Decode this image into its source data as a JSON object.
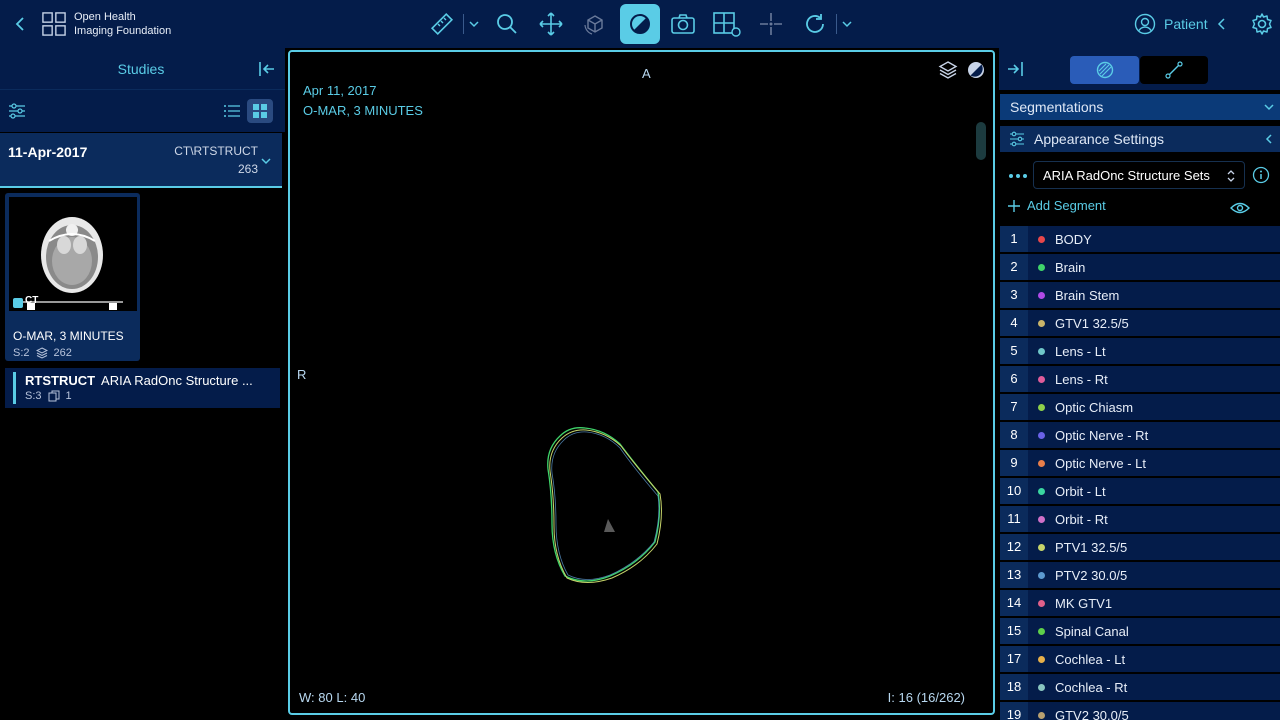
{
  "header": {
    "org_line1": "Open Health",
    "org_line2": "Imaging Foundation",
    "patient_label": "Patient"
  },
  "left_panel": {
    "title": "Studies",
    "study": {
      "date": "11-Apr-2017",
      "modalities": "CT\\RTSTRUCT",
      "instance_count": "263"
    },
    "series": {
      "thumb_label": "CT",
      "description": "O-MAR, 3 MINUTES",
      "series_num": "S:2",
      "instances": "262"
    },
    "rtstruct": {
      "modality": "RTSTRUCT",
      "description": "ARIA RadOnc Structure ...",
      "series_num": "S:3",
      "instances": "1"
    }
  },
  "viewport": {
    "date": "Apr 11, 2017",
    "description": "O-MAR, 3 MINUTES",
    "orientation_top": "A",
    "orientation_left": "R",
    "window_label": "W:",
    "window_value": "80",
    "level_label": "L:",
    "level_value": "40",
    "image_index": "I: 16 (16/262)"
  },
  "right_panel": {
    "segmentations_title": "Segmentations",
    "appearance_title": "Appearance Settings",
    "structure_set": "ARIA RadOnc Structure Sets",
    "add_segment_label": "Add Segment",
    "segments": [
      {
        "num": "1",
        "label": "BODY",
        "color": "#e8474b"
      },
      {
        "num": "2",
        "label": "Brain",
        "color": "#3fd46a"
      },
      {
        "num": "3",
        "label": "Brain Stem",
        "color": "#b04ae8"
      },
      {
        "num": "4",
        "label": "GTV1 32.5/5",
        "color": "#c9b46a"
      },
      {
        "num": "5",
        "label": "Lens - Lt",
        "color": "#6fc7c9"
      },
      {
        "num": "6",
        "label": "Lens - Rt",
        "color": "#e05c9a"
      },
      {
        "num": "7",
        "label": "Optic Chiasm",
        "color": "#8ed04a"
      },
      {
        "num": "8",
        "label": "Optic Nerve - Rt",
        "color": "#6a62e8"
      },
      {
        "num": "9",
        "label": "Optic Nerve - Lt",
        "color": "#e87e4a"
      },
      {
        "num": "10",
        "label": "Orbit - Lt",
        "color": "#3ad6a0"
      },
      {
        "num": "11",
        "label": "Orbit - Rt",
        "color": "#d070c8"
      },
      {
        "num": "12",
        "label": "PTV1 32.5/5",
        "color": "#c6d46a"
      },
      {
        "num": "13",
        "label": "PTV2 30.0/5",
        "color": "#5c9ad0"
      },
      {
        "num": "14",
        "label": "MK GTV1",
        "color": "#e0608a"
      },
      {
        "num": "15",
        "label": "Spinal Canal",
        "color": "#5ed04a"
      },
      {
        "num": "17",
        "label": "Cochlea - Lt",
        "color": "#e8b04a"
      },
      {
        "num": "18",
        "label": "Cochlea - Rt",
        "color": "#8ac6c0"
      },
      {
        "num": "19",
        "label": "GTV2 30.0/5",
        "color": "#b8a070"
      }
    ]
  },
  "colors": {
    "accent": "#5acce6",
    "header_bg": "#041c4a",
    "panel_bg": "#0b2b5c",
    "active_tab": "#2a5cb8"
  }
}
